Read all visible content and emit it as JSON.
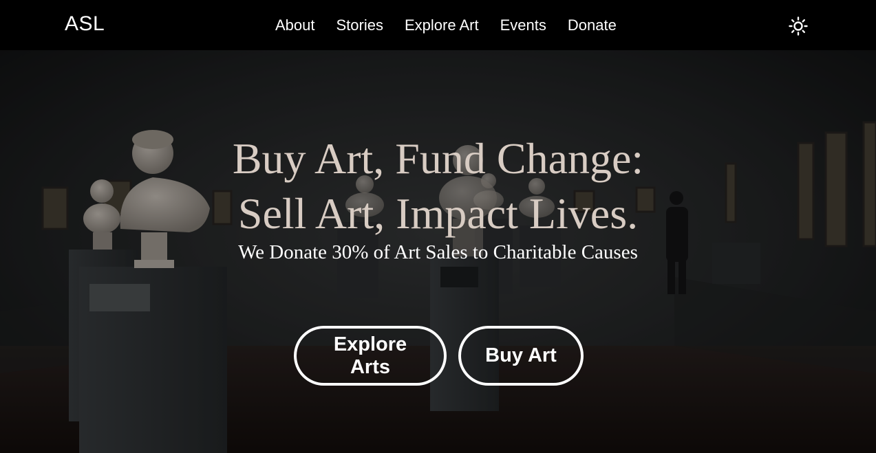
{
  "brand": {
    "name": "ASL"
  },
  "nav": {
    "items": [
      {
        "label": "About"
      },
      {
        "label": "Stories"
      },
      {
        "label": "Explore Art"
      },
      {
        "label": "Events"
      },
      {
        "label": "Donate"
      }
    ]
  },
  "theme_toggle": {
    "icon": "sun-icon"
  },
  "hero": {
    "headline_line1": "Buy Art, Fund Change:",
    "headline_line2": "Sell Art, Impact Lives.",
    "subheadline": "We Donate 30% of Art Sales to Charitable Causes",
    "buttons": {
      "explore_label": "Explore Arts",
      "buy_label": "Buy Art"
    }
  },
  "colors": {
    "navbar_bg": "#000000",
    "headline": "#d8ccc3",
    "text": "#ffffff"
  }
}
